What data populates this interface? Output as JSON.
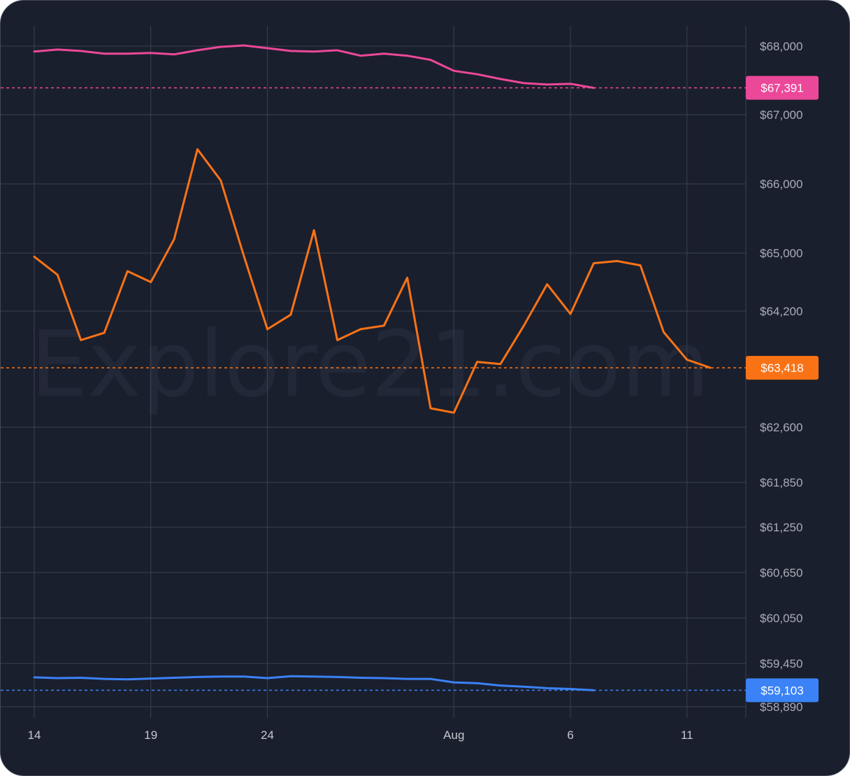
{
  "watermark": "Explore21.com",
  "colors": {
    "background": "#1a1f2d",
    "grid": "#3a4050",
    "series": [
      "#ec4899",
      "#f97316",
      "#3b82f6"
    ]
  },
  "chart_data": {
    "type": "line",
    "x_labels": [
      "14",
      "19",
      "24",
      "Aug",
      "6",
      "11"
    ],
    "x_label_days": [
      0,
      5,
      10,
      18,
      23,
      28
    ],
    "dates": [
      "Jul 14",
      "Jul 15",
      "Jul 16",
      "Jul 17",
      "Jul 18",
      "Jul 19",
      "Jul 20",
      "Jul 21",
      "Jul 22",
      "Jul 23",
      "Jul 24",
      "Jul 25",
      "Jul 26",
      "Jul 27",
      "Jul 28",
      "Jul 29",
      "Jul 30",
      "Jul 31",
      "Aug 1",
      "Aug 2",
      "Aug 3",
      "Aug 4",
      "Aug 5",
      "Aug 6",
      "Aug 7",
      "Aug 8",
      "Aug 9",
      "Aug 10",
      "Aug 11",
      "Aug 12"
    ],
    "y_ticks": [
      "$68,000",
      "$67,000",
      "$66,000",
      "$65,000",
      "$64,200",
      "$62,600",
      "$61,850",
      "$61,250",
      "$60,650",
      "$60,050",
      "$59,450",
      "$58,890"
    ],
    "y_tick_values": [
      68000,
      67000,
      66000,
      65000,
      64200,
      62600,
      61850,
      61250,
      60650,
      60050,
      59450,
      58890
    ],
    "series": [
      {
        "color": "#ec4899",
        "last_value_label": "$67,391",
        "last_value": 67391,
        "values": [
          67920,
          67950,
          67930,
          67890,
          67890,
          67900,
          67880,
          67940,
          67990,
          68010,
          67970,
          67930,
          67920,
          67940,
          67860,
          67890,
          67860,
          67800,
          67640,
          67590,
          67520,
          67460,
          67440,
          67450,
          67391
        ]
      },
      {
        "color": "#f97316",
        "last_value_label": "$63,418",
        "last_value": 63418,
        "values": [
          64950,
          64700,
          63800,
          63900,
          64750,
          64600,
          65200,
          66500,
          66050,
          64950,
          63950,
          64150,
          65330,
          63800,
          63950,
          64000,
          64660,
          62860,
          62800,
          63500,
          63470,
          64000,
          64570,
          64160,
          64860,
          64890,
          64830,
          63910,
          63530,
          63418
        ]
      },
      {
        "color": "#3b82f6",
        "last_value_label": "$59,103",
        "last_value": 59103,
        "values": [
          59270,
          59260,
          59265,
          59250,
          59245,
          59255,
          59265,
          59275,
          59280,
          59280,
          59260,
          59285,
          59280,
          59275,
          59265,
          59260,
          59250,
          59250,
          59205,
          59195,
          59165,
          59150,
          59130,
          59120,
          59103
        ]
      }
    ]
  }
}
